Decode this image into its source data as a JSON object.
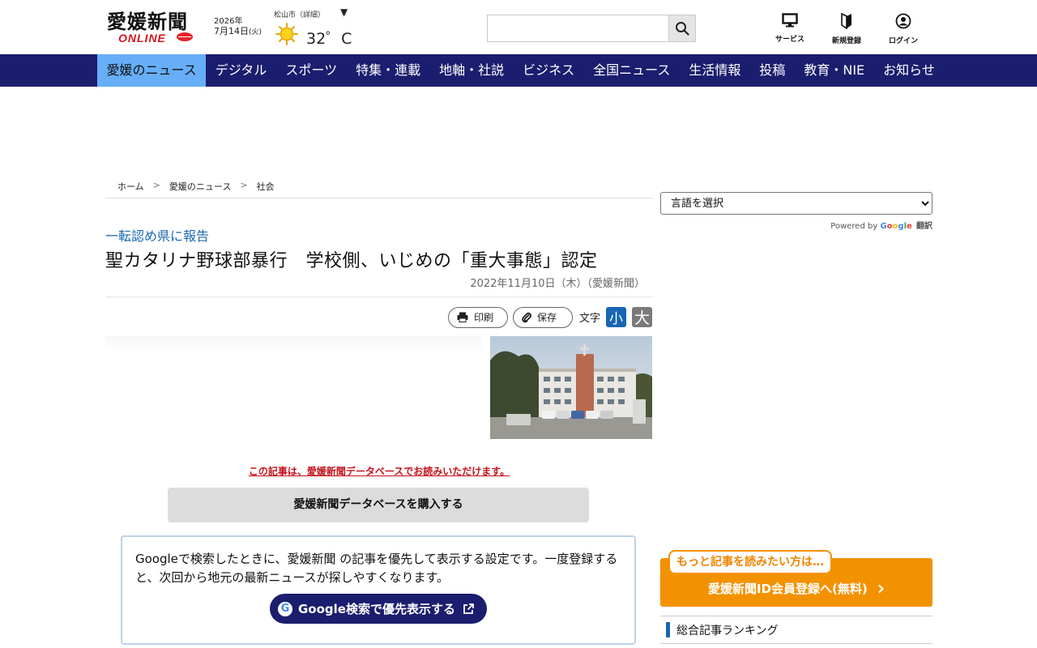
{
  "header": {
    "logo_text": "愛媛新聞",
    "logo_sub": "ONLINE",
    "date": {
      "year": "2026年",
      "month_day": "7月14日",
      "weekday": "(火)"
    },
    "weather": {
      "city": "松山市（詳細）",
      "toggle": "▼",
      "icon": "sun-icon",
      "temperature": "32゜C"
    },
    "search": {
      "placeholder": "",
      "value": "",
      "button_icon": "search-icon"
    },
    "icons": [
      {
        "label": "サービス",
        "icon": "monitor-icon"
      },
      {
        "label": "新規登録",
        "icon": "beginner-mark-icon"
      },
      {
        "label": "ログイン",
        "icon": "user-icon"
      }
    ]
  },
  "nav": {
    "items": [
      "愛媛のニュース",
      "デジタル",
      "スポーツ",
      "特集・連載",
      "地軸・社説",
      "ビジネス",
      "全国ニュース",
      "生活情報",
      "投稿",
      "教育・NIE",
      "お知らせ"
    ],
    "active_index": 0
  },
  "breadcrumb": [
    "ホーム",
    "愛媛のニュース",
    "社会"
  ],
  "breadcrumb_sep": ">",
  "article": {
    "kicker": "一転認め県に報告",
    "headline": "聖カタリナ野球部暴行　学校側、いじめの「重大事態」認定",
    "pubdate": "2022年11月10日（木）（愛媛新聞）",
    "tools": {
      "print_label": "印刷",
      "save_label": "保存",
      "font_size_label": "文字",
      "font_small": "小",
      "font_large": "大"
    },
    "db_notice": "この記事は、愛媛新聞データベースでお読みいただけます。",
    "buy_button": "愛媛新聞データベースを購入する",
    "google_box": {
      "text": "Googleで検索したときに、愛媛新聞 の記事を優先して表示する設定です。一度登録すると、次回から地元の最新ニュースが探しやすくなります。",
      "button": "Google検索で優先表示する"
    }
  },
  "sidebar": {
    "language_select": "言語を選択",
    "powered_by": "Powered by",
    "google_word": "Google",
    "translate_word": "翻訳",
    "signup_bubble": "もっと記事を読みたい方は…",
    "signup_text": "愛媛新聞ID会員登録へ(無料)",
    "ranking_title": "総合記事ランキング"
  },
  "colors": {
    "nav_bg": "#1b1d6e",
    "nav_active": "#66aef7",
    "kicker": "#1a68b3",
    "notice_red": "#c4131b",
    "signup_orange": "#f39200",
    "accent_blue": "#1666b4"
  }
}
